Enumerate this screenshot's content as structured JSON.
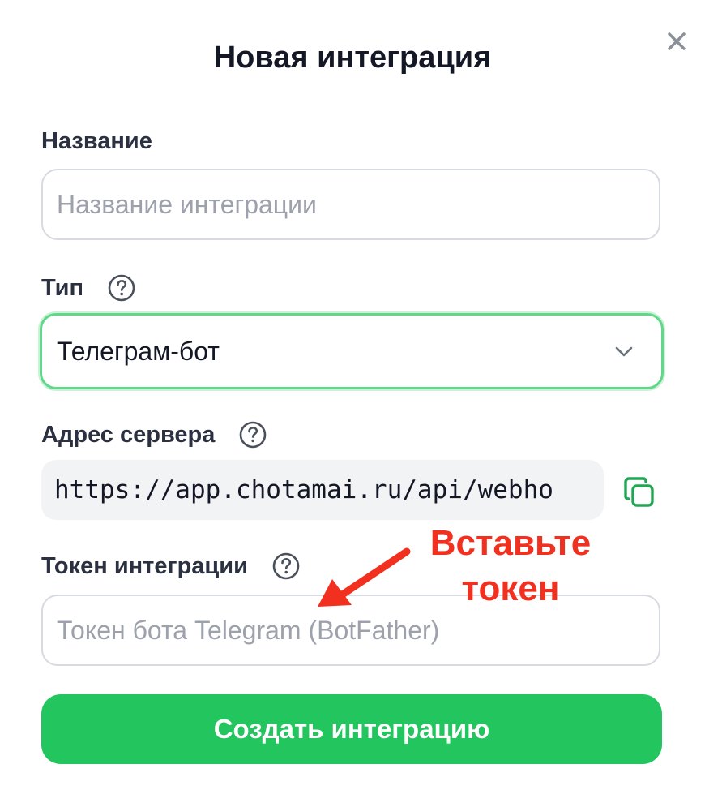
{
  "dialog": {
    "title": "Новая интеграция",
    "close_icon": "close-icon"
  },
  "name_field": {
    "label": "Название",
    "placeholder": "Название интеграции",
    "value": ""
  },
  "type_field": {
    "label": "Тип",
    "help_icon": "help-circle-icon",
    "selected": "Телеграм-бот",
    "chevron_icon": "chevron-down-icon"
  },
  "server_field": {
    "label": "Адрес сервера",
    "help_icon": "help-circle-icon",
    "value": "https://app.chotamai.ru/api/webho",
    "copy_icon": "copy-icon"
  },
  "token_field": {
    "label": "Токен интеграции",
    "help_icon": "help-circle-icon",
    "placeholder": "Токен бота Telegram (BotFather)",
    "value": ""
  },
  "annotation": {
    "line1": "Вставьте",
    "line2": "токен",
    "color": "#f2301f"
  },
  "submit": {
    "label": "Создать интеграцию",
    "color": "#22c55e"
  }
}
